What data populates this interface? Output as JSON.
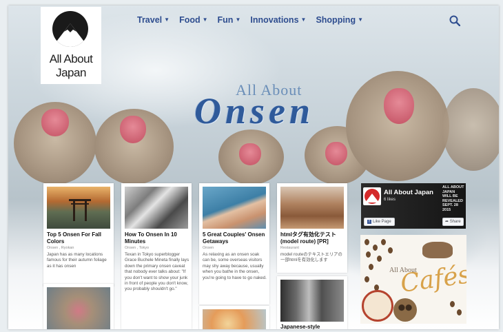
{
  "nav": {
    "logo_line1": "All About",
    "logo_line2": "Japan",
    "menu": [
      {
        "label": "Travel"
      },
      {
        "label": "Food"
      },
      {
        "label": "Fun"
      },
      {
        "label": "Innovations"
      },
      {
        "label": "Shopping"
      }
    ]
  },
  "hero": {
    "subtitle": "All About",
    "title": "Onsen"
  },
  "cards": [
    {
      "title": "Top 5 Onsen For Fall Colors",
      "tags": "Onsen , Ryokan",
      "desc": "Japan has as many locations famous for their autumn foliage as it has onsen"
    },
    {
      "title": "How To Onsen In 10 Minutes",
      "tags": "Onsen , Tokyo",
      "desc": "Texan in Tokyo superblogger Grace Buchele Mineta finally lays down the primary onsen caveat that nobody ever talks about: \"If you don't want to show your junk in front of people you don't know, you probably shouldn't go.\""
    },
    {
      "title": "5 Great Couples' Onsen Getaways",
      "tags": "Onsen",
      "desc": "As relaxing as an onsen soak can be, some overseas visitors may shy away because, usually when you bathe in the onsen, you're going to have to go naked."
    },
    {
      "title": "htmlタグ有効化テスト(model route) [PR]",
      "tags": "Restaurant",
      "desc": "model routeのテキストエリアの一部htmlを有効化します"
    },
    {
      "title": "Japanese-style",
      "tags": "",
      "desc": ""
    }
  ],
  "facebook": {
    "page_name": "All About Japan",
    "likes": "6 likes",
    "like_button": "Like Page",
    "share_button": "Share",
    "cover_text": "ALL ABOUT JAPAN WILL BE REVEALED SEPT. 28 2015"
  },
  "ad": {
    "small": "All About",
    "big": "Cafés"
  },
  "colors": {
    "nav_link": "#2e4d8f",
    "onsen_title": "#2f5a9a",
    "facebook_blue": "#3b5998"
  }
}
